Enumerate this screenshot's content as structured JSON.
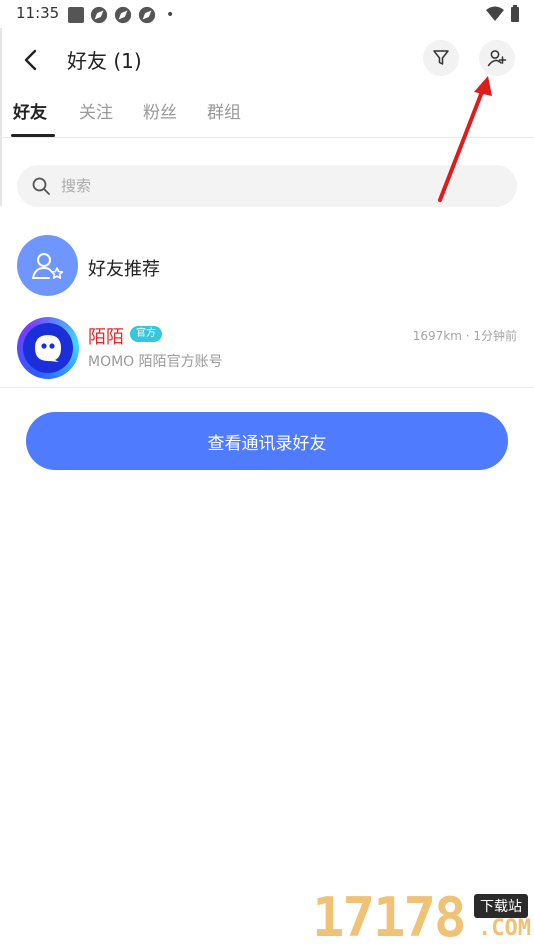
{
  "status_bar": {
    "time": "11:35",
    "dot": "•"
  },
  "header": {
    "title": "好友 (1)"
  },
  "tabs": [
    {
      "label": "好友",
      "active": true
    },
    {
      "label": "关注",
      "active": false
    },
    {
      "label": "粉丝",
      "active": false
    },
    {
      "label": "群组",
      "active": false
    }
  ],
  "search": {
    "placeholder": "搜索",
    "value": ""
  },
  "recommend": {
    "label": "好友推荐"
  },
  "friends": [
    {
      "name": "陌陌",
      "badge": "官方",
      "meta": "1697km · 1分钟前",
      "description": "MOMO 陌陌官方账号"
    }
  ],
  "contacts_button": {
    "label": "查看通讯录好友"
  },
  "watermark": {
    "digits": "17178",
    "tag": "下载站",
    "com": ".COM"
  },
  "colors": {
    "accent": "#4f7cff",
    "official_badge": "#36c6e0",
    "name_red": "#e8262b",
    "annotation_arrow": "#e01b1b"
  }
}
